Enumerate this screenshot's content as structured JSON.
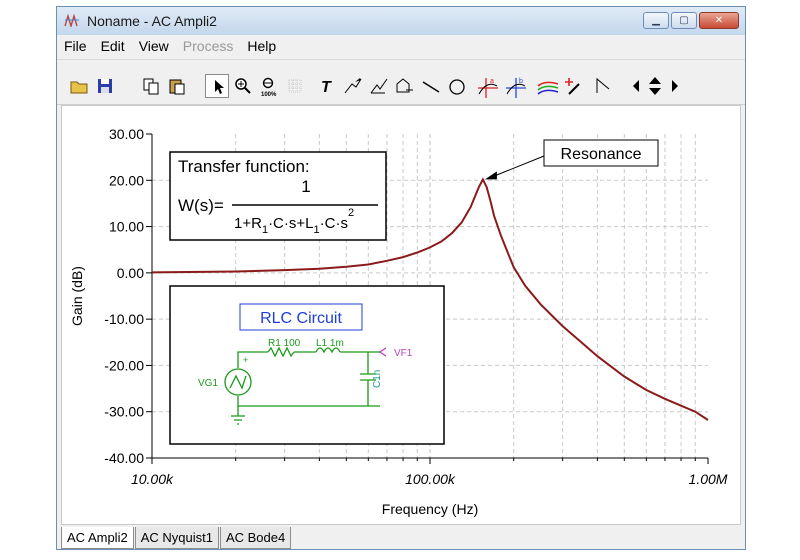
{
  "window": {
    "title": "Noname - AC Ampli2"
  },
  "menu": [
    {
      "label": "File",
      "enabled": true
    },
    {
      "label": "Edit",
      "enabled": true
    },
    {
      "label": "View",
      "enabled": true
    },
    {
      "label": "Process",
      "enabled": false
    },
    {
      "label": "Help",
      "enabled": true
    }
  ],
  "toolbar": {
    "zoom_full_label": "100%"
  },
  "chart_data": {
    "type": "line",
    "xscale": "log",
    "xlabel": "Frequency (Hz)",
    "ylabel": "Gain (dB)",
    "xlim": [
      10000,
      1000000
    ],
    "ylim": [
      -40,
      30
    ],
    "yticks": [
      "30.00",
      "20.00",
      "10.00",
      "0.00",
      "-10.00",
      "-20.00",
      "-30.00",
      "-40.00"
    ],
    "xticks": [
      "10.00k",
      "100.00k",
      "1.00M"
    ],
    "grid": true,
    "line_color": "#8b1a1a",
    "resonance_label": "Resonance",
    "series": [
      {
        "x": [
          10000,
          15000,
          20000,
          30000,
          40000,
          50000,
          60000,
          70000,
          80000,
          90000,
          100000,
          110000,
          120000,
          130000,
          140000,
          150000,
          155000,
          160000,
          165000,
          170000,
          180000,
          190000,
          200000,
          220000,
          250000,
          300000,
          350000,
          400000,
          500000,
          600000,
          700000,
          800000,
          900000,
          1000000
        ],
        "y": [
          0.1,
          0.2,
          0.3,
          0.6,
          0.9,
          1.3,
          1.8,
          2.6,
          3.4,
          4.4,
          5.5,
          6.8,
          8.6,
          10.9,
          14.2,
          18.6,
          20.2,
          18.5,
          15.5,
          12.3,
          8.0,
          4.5,
          1.2,
          -2.8,
          -6.8,
          -11.5,
          -15.0,
          -18.0,
          -22.4,
          -25.3,
          -27.2,
          -28.7,
          -30.0,
          -31.8
        ]
      }
    ]
  },
  "transfer_function": {
    "heading": "Transfer function:",
    "lhs": "W(s)=",
    "numerator": "1",
    "denominator": "1+R1·C·s+L1·C·s2"
  },
  "circuit": {
    "title": "RLC Circuit",
    "labels": {
      "r1": "R1 100",
      "l1": "L1 1m",
      "c1": "C1n",
      "vg": "VG1",
      "vf": "VF1",
      "plus": "+"
    },
    "colors": {
      "title": "#1f3fd6",
      "components": "#1a9a1a",
      "output": "#c040c0",
      "capacitor_label": "#1a9a8a"
    }
  },
  "tabs": [
    {
      "label": "AC Ampli2",
      "active": true
    },
    {
      "label": "AC Nyquist1",
      "active": false
    },
    {
      "label": "AC Bode4",
      "active": false
    }
  ]
}
